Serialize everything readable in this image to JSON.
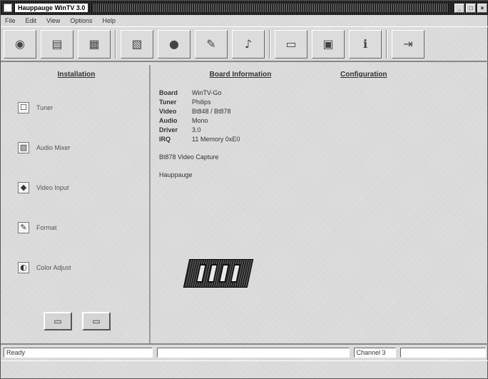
{
  "window": {
    "title": "Hauppauge WinTV 3.0",
    "controls": [
      "_",
      "□",
      "×"
    ]
  },
  "menu": {
    "items": [
      "File",
      "Edit",
      "View",
      "Options",
      "Help"
    ]
  },
  "toolbar": {
    "buttons": [
      {
        "name": "tv-icon",
        "glyph": "◉"
      },
      {
        "name": "tuner-icon",
        "glyph": "▤"
      },
      {
        "name": "channel-icon",
        "glyph": "▦"
      },
      {
        "name": "capture-icon",
        "glyph": "▧"
      },
      {
        "name": "record-icon",
        "glyph": "●"
      },
      {
        "name": "settings-icon",
        "glyph": "✎"
      },
      {
        "name": "audio-icon",
        "glyph": "♪"
      },
      {
        "name": "video-icon",
        "glyph": "▭"
      },
      {
        "name": "snapshot-icon",
        "glyph": "▣"
      },
      {
        "name": "info-icon",
        "glyph": "ℹ"
      },
      {
        "name": "exit-icon",
        "glyph": "⇥"
      }
    ]
  },
  "left_pane": {
    "header": "Installation",
    "options": [
      {
        "icon": "☐",
        "label": "Tuner"
      },
      {
        "icon": "▧",
        "label": "Audio Mixer"
      },
      {
        "icon": "◆",
        "label": "Video Input"
      },
      {
        "icon": "✎",
        "label": "Format"
      },
      {
        "icon": "◐",
        "label": "Color Adjust"
      }
    ],
    "buttons": [
      {
        "glyph": "▭"
      },
      {
        "glyph": "▭"
      }
    ]
  },
  "mid_pane": {
    "header": "Board Information",
    "rows": [
      {
        "k": "Board",
        "v": "WinTV-Go"
      },
      {
        "k": "Tuner",
        "v": "Philips"
      },
      {
        "k": "Video",
        "v": "Bt848 / Bt878"
      },
      {
        "k": "Audio",
        "v": "Mono"
      },
      {
        "k": "Driver",
        "v": "3.0"
      },
      {
        "k": "IRQ",
        "v": "11  Memory  0xE0"
      }
    ],
    "extra1": "Bt878 Video Capture",
    "extra2": "Hauppauge"
  },
  "right_pane": {
    "header": "Configuration"
  },
  "status": {
    "left": "Ready",
    "right": "Channel 3"
  }
}
